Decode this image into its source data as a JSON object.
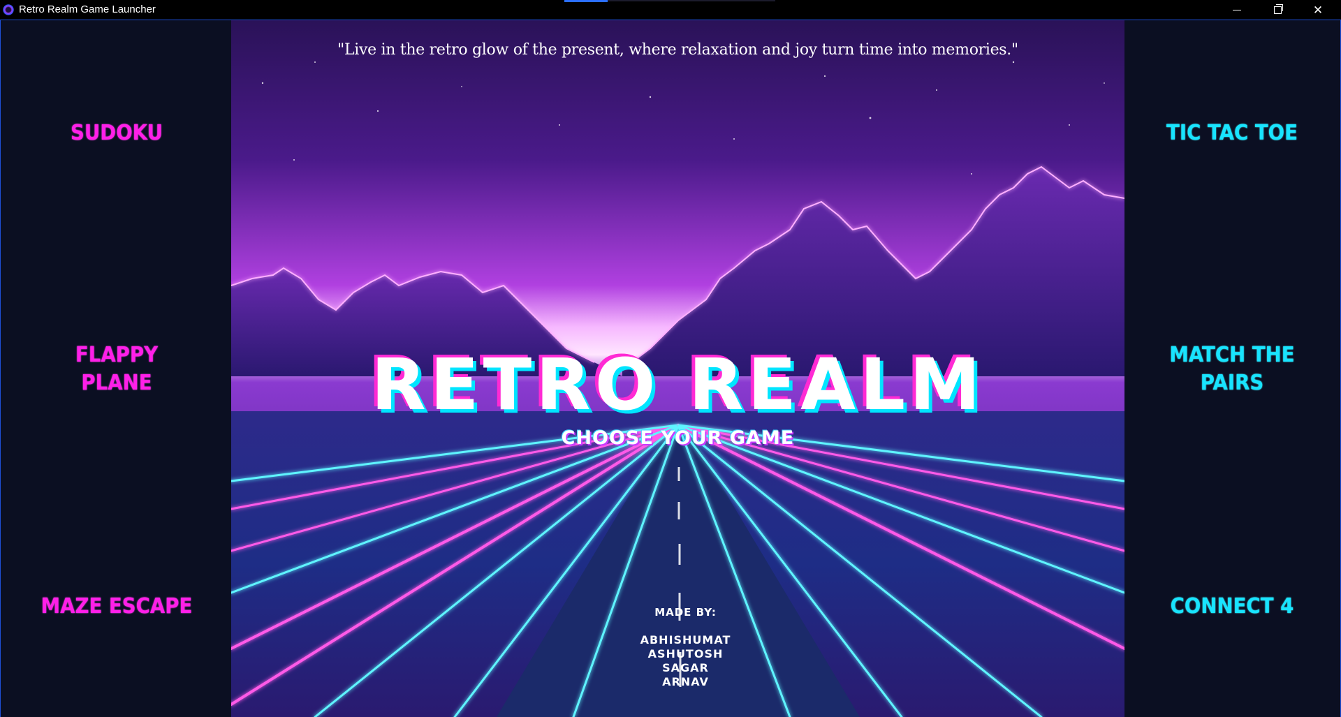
{
  "window": {
    "title": "Retro Realm Game Launcher",
    "controls": {
      "minimize_icon": "minimize-icon",
      "maximize_icon": "restore-icon",
      "close_icon": "close-icon"
    }
  },
  "left_games": [
    {
      "label": "SUDOKU",
      "color": "#ff1fe8"
    },
    {
      "label_lines": [
        "FLAPPY",
        "PLANE"
      ],
      "color": "#ff1fe8"
    },
    {
      "label": "MAZE ESCAPE",
      "color": "#ff1fe8"
    }
  ],
  "right_games": [
    {
      "label": "TIC TAC TOE",
      "color": "#18e4ff"
    },
    {
      "label_lines": [
        "MATCH THE",
        "PAIRS"
      ],
      "color": "#18e4ff"
    },
    {
      "label": "CONNECT 4",
      "color": "#18e4ff"
    }
  ],
  "banner": {
    "quote": "\"Live in the retro glow of the present, where relaxation and joy turn time into memories.\"",
    "title": "RETRO REALM",
    "subtitle": "CHOOSE YOUR GAME",
    "credits_heading": "MADE BY:",
    "credits": [
      "ABHISHUMAT",
      "ASHUTOSH",
      "SAGAR",
      "ARNAV"
    ]
  },
  "colors": {
    "background": "#0b0f22",
    "accent_pink": "#ff1fe8",
    "accent_cyan": "#18e4ff",
    "titlebar": "#000000"
  }
}
